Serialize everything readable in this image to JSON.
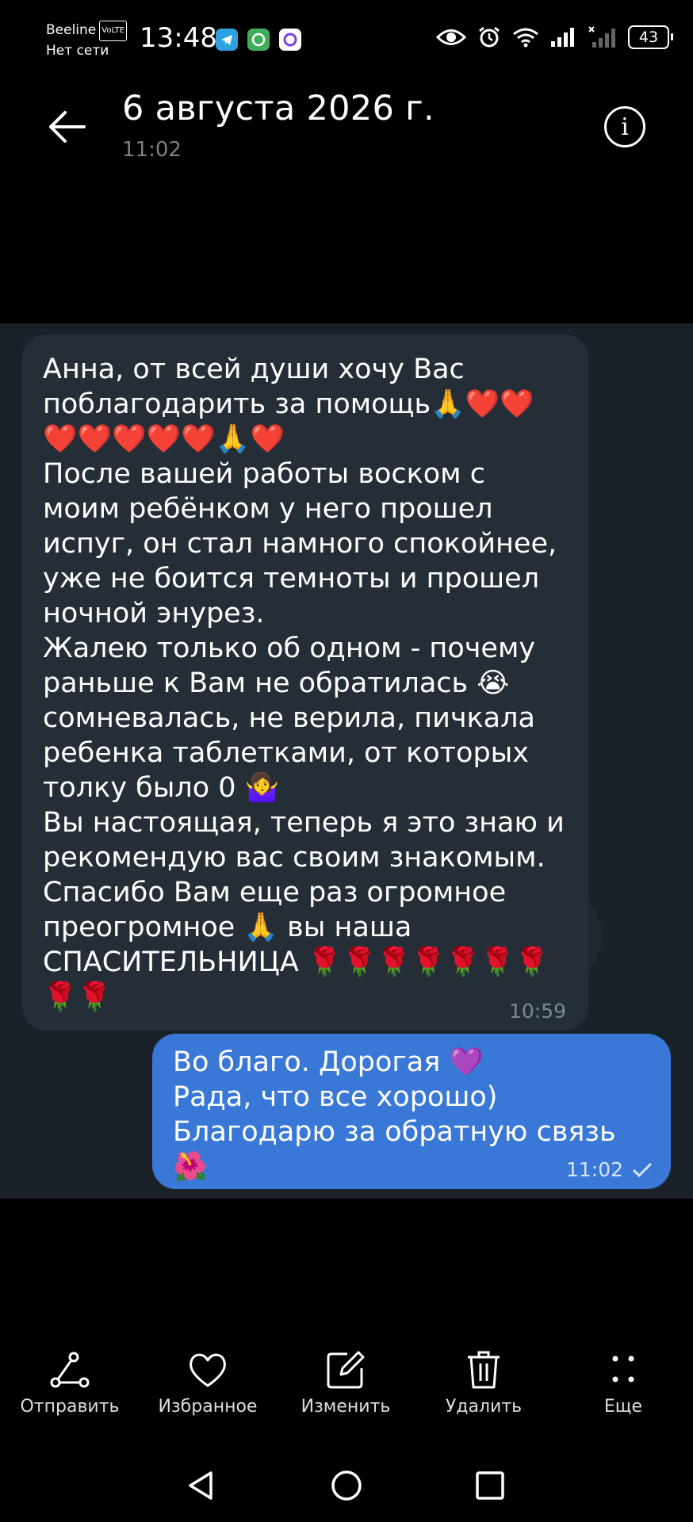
{
  "status_bar": {
    "carrier": "Beeline",
    "volte": "VoLTE",
    "network_status": "Нет сети",
    "time": "13:48",
    "battery": "43",
    "icons": [
      "telegram-icon",
      "whatsapp-like-icon",
      "app-icon",
      "eye-icon",
      "alarm-icon",
      "wifi-icon",
      "signal-icon",
      "signal-off-icon",
      "battery-icon"
    ]
  },
  "header": {
    "title": "6 августа 2026 г.",
    "subtitle": "11:02"
  },
  "messages": [
    {
      "direction": "incoming",
      "text": "Анна, от всей души хочу Вас поблагодарить за помощь🙏❤️❤️❤️❤️❤️❤️❤️🙏❤️\nПосле вашей работы воском с моим ребёнком у него прошел испуг, он стал намного спокойнее, уже не боится темноты и прошел ночной энурез.\nЖалею только об одном - почему раньше к Вам не обратилась 😭 сомневалась, не верила, пичкала ребенка таблетками, от которых толку было 0 🤷‍♀️\nВы настоящая, теперь я это знаю и рекомендую вас своим знакомым. Спасибо Вам еще раз огромное преогромное 🙏 вы наша СПАСИТЕЛЬНИЦА 🌹🌹🌹🌹🌹🌹🌹🌹🌹",
      "time": "10:59"
    },
    {
      "direction": "outgoing",
      "text": "Во благо. Дорогая 💜\nРада, что все хорошо)\nБлагодарю за обратную связь 🌺",
      "time": "11:02",
      "status": "sent"
    }
  ],
  "actions": [
    {
      "label": "Отправить",
      "icon": "share-icon"
    },
    {
      "label": "Избранное",
      "icon": "heart-icon"
    },
    {
      "label": "Изменить",
      "icon": "edit-icon"
    },
    {
      "label": "Удалить",
      "icon": "trash-icon"
    },
    {
      "label": "Еще",
      "icon": "more-icon"
    }
  ],
  "colors": {
    "background": "#000000",
    "chat_bg": "#1a2129",
    "incoming_bubble": "#252e37",
    "outgoing_bubble": "#3a78d8"
  }
}
